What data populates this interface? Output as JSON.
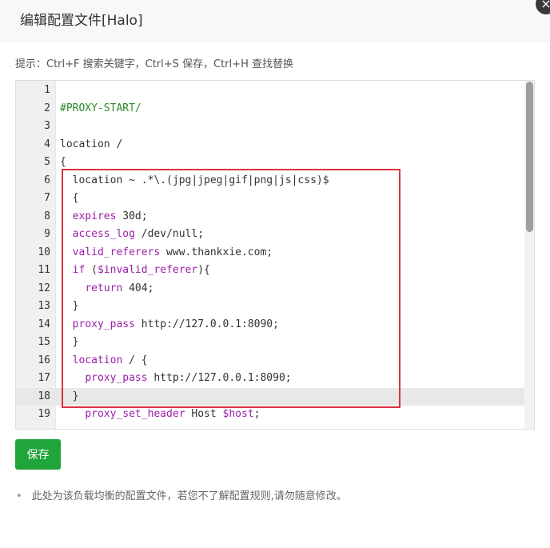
{
  "dialog": {
    "title": "编辑配置文件[Halo]",
    "close_icon": "×"
  },
  "hint": "提示：Ctrl+F 搜索关键字，Ctrl+S 保存，Ctrl+H 查找替换",
  "editor": {
    "lines": [
      {
        "no": "1",
        "indent": "",
        "parts": []
      },
      {
        "no": "2",
        "indent": "",
        "parts": [
          {
            "t": "#PROXY-START/",
            "c": "cm"
          }
        ]
      },
      {
        "no": "3",
        "indent": "",
        "parts": []
      },
      {
        "no": "4",
        "indent": "",
        "parts": [
          {
            "t": "location /",
            "c": "st"
          }
        ]
      },
      {
        "no": "5",
        "indent": "",
        "parts": [
          {
            "t": "{",
            "c": "st"
          }
        ]
      },
      {
        "no": "6",
        "indent": "  ",
        "parts": [
          {
            "t": "location ~ .*\\.(jpg|jpeg|gif|png|js|css)$",
            "c": "st"
          }
        ]
      },
      {
        "no": "7",
        "indent": "  ",
        "parts": [
          {
            "t": "{",
            "c": "st"
          }
        ]
      },
      {
        "no": "8",
        "indent": "  ",
        "parts": [
          {
            "t": "expires",
            "c": "kw"
          },
          {
            "t": " 30d;",
            "c": "st"
          }
        ]
      },
      {
        "no": "9",
        "indent": "  ",
        "parts": [
          {
            "t": "access_log",
            "c": "kw"
          },
          {
            "t": " /dev/null;",
            "c": "st"
          }
        ]
      },
      {
        "no": "10",
        "indent": "  ",
        "parts": [
          {
            "t": "valid_referers",
            "c": "kw"
          },
          {
            "t": " www.thankxie.com;",
            "c": "st"
          }
        ]
      },
      {
        "no": "11",
        "indent": "  ",
        "parts": [
          {
            "t": "if",
            "c": "kw"
          },
          {
            "t": " (",
            "c": "st"
          },
          {
            "t": "$invalid_referer",
            "c": "vr"
          },
          {
            "t": "){",
            "c": "st"
          }
        ]
      },
      {
        "no": "12",
        "indent": "    ",
        "parts": [
          {
            "t": "return",
            "c": "kw"
          },
          {
            "t": " 404;",
            "c": "st"
          }
        ]
      },
      {
        "no": "13",
        "indent": "  ",
        "parts": [
          {
            "t": "}",
            "c": "st"
          }
        ]
      },
      {
        "no": "14",
        "indent": "  ",
        "parts": [
          {
            "t": "proxy_pass",
            "c": "kw"
          },
          {
            "t": " http://127.0.0.1:8090;",
            "c": "st"
          }
        ]
      },
      {
        "no": "15",
        "indent": "  ",
        "parts": [
          {
            "t": "}",
            "c": "st"
          }
        ]
      },
      {
        "no": "16",
        "indent": "  ",
        "parts": [
          {
            "t": "location",
            "c": "kw"
          },
          {
            "t": " / {",
            "c": "st"
          }
        ]
      },
      {
        "no": "17",
        "indent": "    ",
        "parts": [
          {
            "t": "proxy_pass",
            "c": "kw"
          },
          {
            "t": " http://127.0.0.1:8090;",
            "c": "st"
          }
        ]
      },
      {
        "no": "18",
        "indent": "  ",
        "parts": [
          {
            "t": "}",
            "c": "st"
          }
        ],
        "active": true
      },
      {
        "no": "19",
        "indent": "    ",
        "parts": [
          {
            "t": "proxy_set_header",
            "c": "kw"
          },
          {
            "t": " Host ",
            "c": "st"
          },
          {
            "t": "$host",
            "c": "vr"
          },
          {
            "t": ";",
            "c": "st"
          }
        ]
      }
    ],
    "colors": {
      "keyword": "#9b1fa8",
      "comment": "#2a8a2a",
      "highlight_box": "#d9343f"
    }
  },
  "save_label": "保存",
  "save_color": "#20a53a",
  "note": "此处为该负载均衡的配置文件，若您不了解配置规则,请勿随意修改。"
}
